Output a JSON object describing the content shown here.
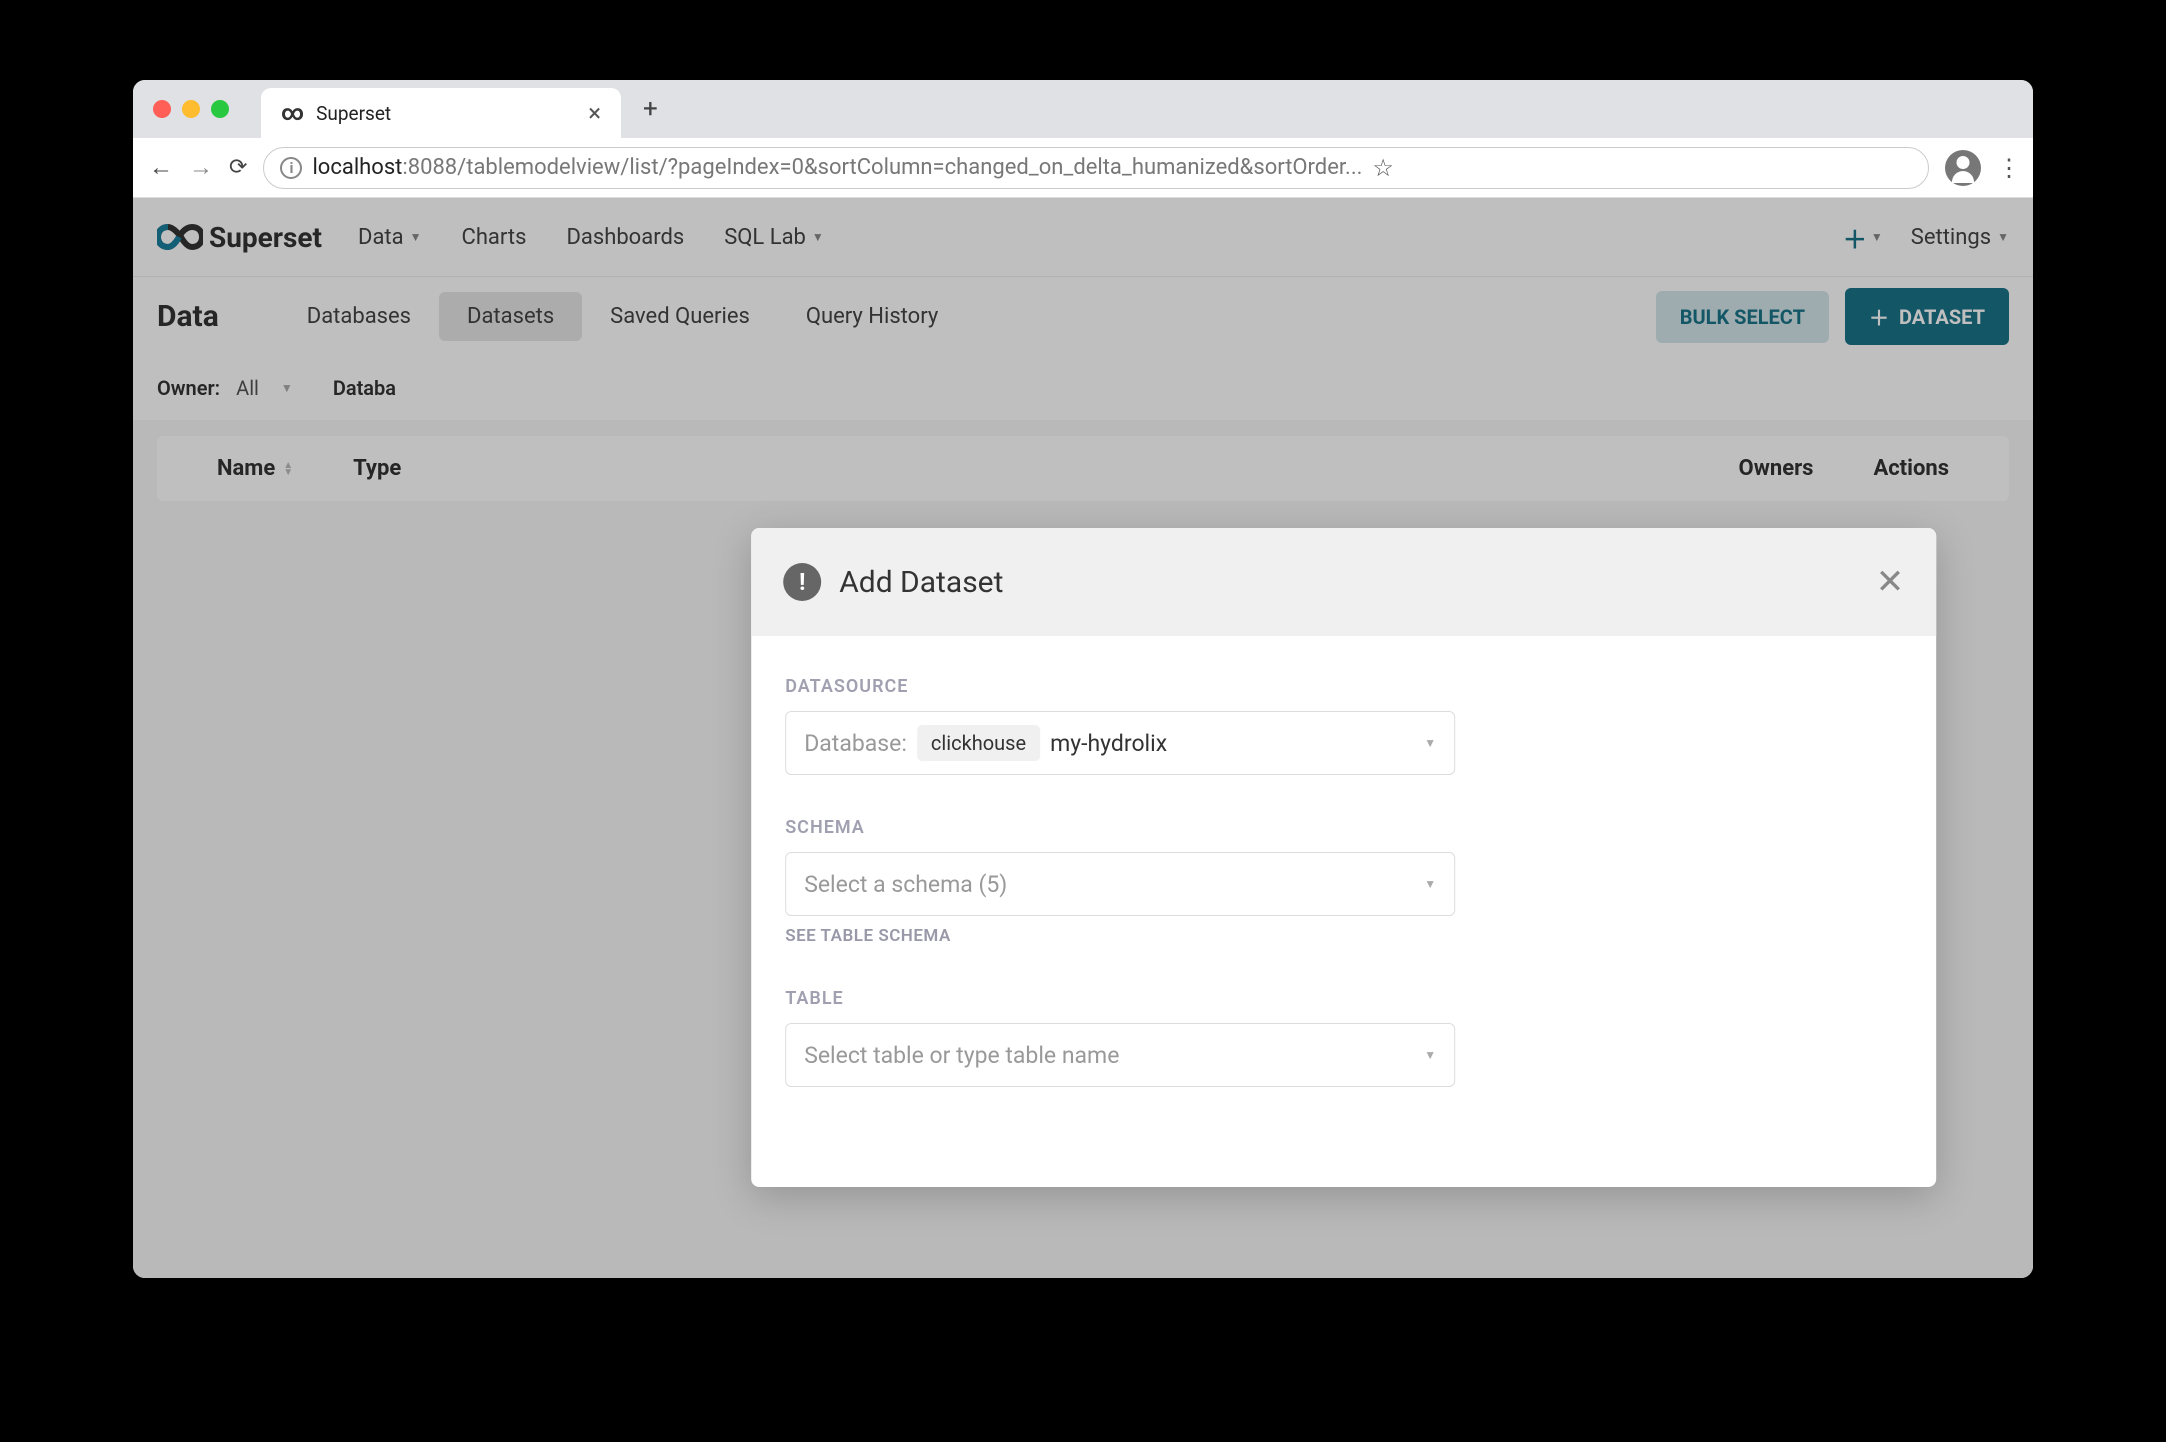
{
  "browser": {
    "tab_title": "Superset",
    "url_host": "localhost",
    "url_rest": ":8088/tablemodelview/list/?pageIndex=0&sortColumn=changed_on_delta_humanized&sortOrder..."
  },
  "header": {
    "logo_text": "Superset",
    "nav": {
      "data": "Data",
      "charts": "Charts",
      "dashboards": "Dashboards",
      "sql": "SQL Lab"
    },
    "settings": "Settings"
  },
  "page": {
    "title": "Data",
    "tabs": {
      "databases": "Databases",
      "datasets": "Datasets",
      "saved": "Saved Queries",
      "history": "Query History"
    },
    "bulk_btn": "BULK SELECT",
    "dataset_btn": "DATASET"
  },
  "filters": {
    "owner_label": "Owner:",
    "owner_val": "All",
    "database_label": "Databa"
  },
  "table": {
    "name": "Name",
    "type": "Type",
    "owners": "Owners",
    "actions": "Actions"
  },
  "modal": {
    "title": "Add Dataset",
    "datasource_label": "DATASOURCE",
    "db_label": "Database:",
    "db_tag": "clickhouse",
    "db_value": "my-hydrolix",
    "schema_label": "SCHEMA",
    "schema_placeholder": "Select a schema (5)",
    "schema_sub": "SEE TABLE SCHEMA",
    "table_label": "TABLE",
    "table_placeholder": "Select table or type table name"
  }
}
